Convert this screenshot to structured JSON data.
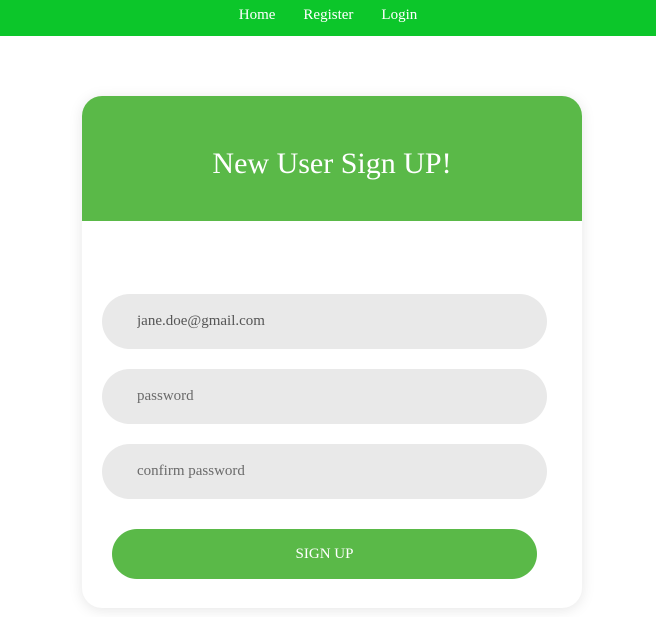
{
  "nav": {
    "links": [
      "Home",
      "Register",
      "Login"
    ]
  },
  "form": {
    "title": "New User Sign UP!",
    "email_value": "jane.doe@gmail.com",
    "password_placeholder": "password",
    "confirm_placeholder": "confirm password",
    "submit_label": "SIGN UP"
  },
  "colors": {
    "nav_background": "#0cc62a",
    "accent": "#5ab948",
    "field_background": "#e9e9e9"
  }
}
